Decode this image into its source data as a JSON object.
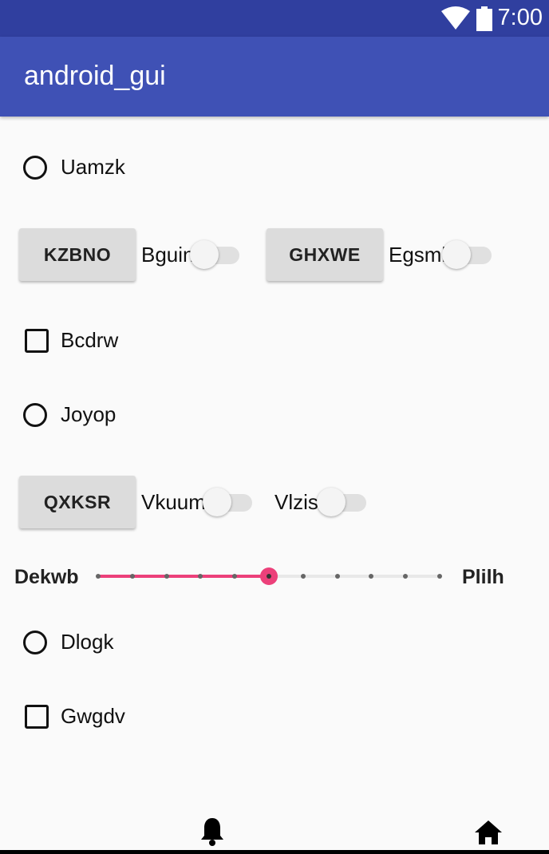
{
  "status_bar": {
    "time": "7:00",
    "icons": [
      "wifi-icon",
      "battery-icon"
    ]
  },
  "app_bar": {
    "title": "android_gui"
  },
  "radios": [
    {
      "label": "Uamzk",
      "checked": false
    },
    {
      "label": "Joyop",
      "checked": false
    },
    {
      "label": "Dlogk",
      "checked": false
    }
  ],
  "checkboxes": [
    {
      "label": "Bcdrw",
      "checked": false
    },
    {
      "label": "Gwgdv",
      "checked": false
    }
  ],
  "buttons": {
    "kzbno": "KZBNO",
    "ghxwe": "GHXWE",
    "qxksr": "QXKSR"
  },
  "switches": [
    {
      "label": "Bguin",
      "on": false
    },
    {
      "label": "Egsml",
      "on": false
    },
    {
      "label": "Vkuum",
      "on": false
    },
    {
      "label": "Vlzis",
      "on": false
    }
  ],
  "seekbar": {
    "left_label": "Dekwb",
    "right_label": "Plilh",
    "max": 10,
    "value": 5,
    "accent": "#ec407a"
  },
  "nav": {
    "icons": [
      "bell-icon",
      "home-icon"
    ]
  },
  "colors": {
    "status_bar": "#303f9f",
    "app_bar": "#3f51b5",
    "accent": "#ec407a"
  }
}
